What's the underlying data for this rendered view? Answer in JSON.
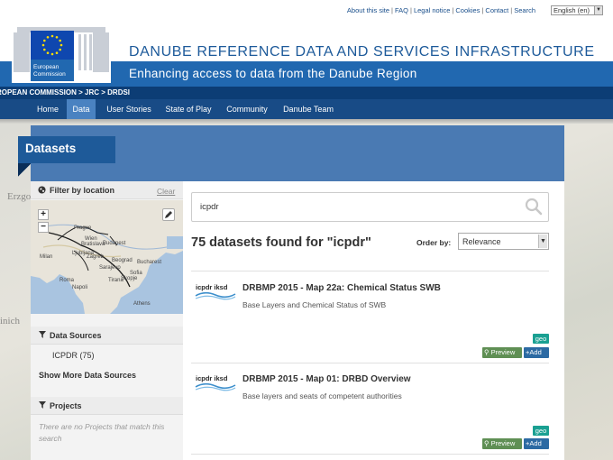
{
  "topbar": {
    "links": [
      "About this site",
      "FAQ",
      "Legal notice",
      "Cookies",
      "Contact",
      "Search"
    ],
    "language": "English (en)"
  },
  "header": {
    "logo_text": [
      "European",
      "Commission"
    ],
    "title": "DANUBE REFERENCE DATA AND SERVICES INFRASTRUCTURE",
    "subtitle": "Enhancing access to data from the Danube Region"
  },
  "breadcrumb": "ROPEAN COMMISSION > JRC > DRDSI",
  "nav": {
    "items": [
      "Home",
      "Data",
      "User Stories",
      "State of Play",
      "Community",
      "Danube Team"
    ],
    "active": "Data"
  },
  "page": {
    "title": "Datasets"
  },
  "background_labels": [
    "Erzgo",
    "inich"
  ],
  "sidebar": {
    "location": {
      "label": "Filter by location",
      "clear": "Clear",
      "zoom_in": "+",
      "zoom_out": "−"
    },
    "map_labels": [
      "Prague",
      "Wien",
      "Bratislava",
      "Budapest",
      "Ljubljana",
      "Zagreb",
      "Beograd",
      "Sarajevo",
      "Bucharest",
      "Sofia",
      "Milan",
      "Roma",
      "Napoli",
      "Athens",
      "Tirana",
      "Skopje"
    ],
    "sources": {
      "label": "Data Sources",
      "items": [
        "ICPDR (75)"
      ],
      "show_more": "Show More Data Sources"
    },
    "projects": {
      "label": "Projects",
      "empty": "There are no Projects that match this search"
    }
  },
  "search": {
    "value": "icpdr"
  },
  "results": {
    "count_text": "75 datasets found for \"icpdr\"",
    "order_label": "Order by:",
    "order_value": "Relevance",
    "logo_text": "icpdr iksd",
    "items": [
      {
        "title": "DRBMP 2015 - Map 22a: Chemical Status SWB",
        "description": "Base Layers and Chemical Status of SWB",
        "badge": "geo",
        "preview": "Preview",
        "add": "Add"
      },
      {
        "title": "DRBMP 2015 - Map 01: DRBD Overview",
        "description": "Base layers and seats of competent authorities",
        "badge": "geo",
        "preview": "Preview",
        "add": "Add"
      }
    ]
  },
  "colors": {
    "brand_blue": "#1d5a9a",
    "nav": "#184b86",
    "geo_badge": "#1aa092",
    "preview": "#5f8f54",
    "add": "#2c6aa3"
  }
}
